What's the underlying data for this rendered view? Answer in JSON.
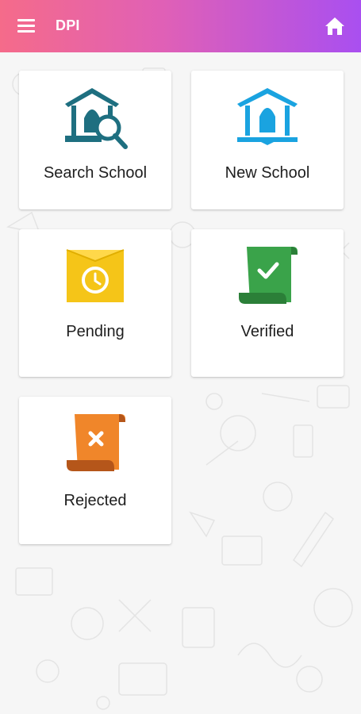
{
  "app_bar": {
    "title": "DPI",
    "menu_icon": "hamburger-menu-icon",
    "home_icon": "home-icon",
    "gradient_colors": [
      "#f56b8a",
      "#e060b6",
      "#a94ff0"
    ]
  },
  "tiles": [
    {
      "label": "Search School",
      "icon": "school-search-icon",
      "color": "#1e6f80"
    },
    {
      "label": "New School",
      "icon": "school-building-icon",
      "color": "#1aa3e0"
    },
    {
      "label": "Pending",
      "icon": "pending-clock-envelope-icon",
      "color": "#f5c518"
    },
    {
      "label": "Verified",
      "icon": "verified-scroll-icon",
      "color": "#3aa34a"
    },
    {
      "label": "Rejected",
      "icon": "rejected-scroll-icon",
      "color": "#f0862a"
    }
  ]
}
